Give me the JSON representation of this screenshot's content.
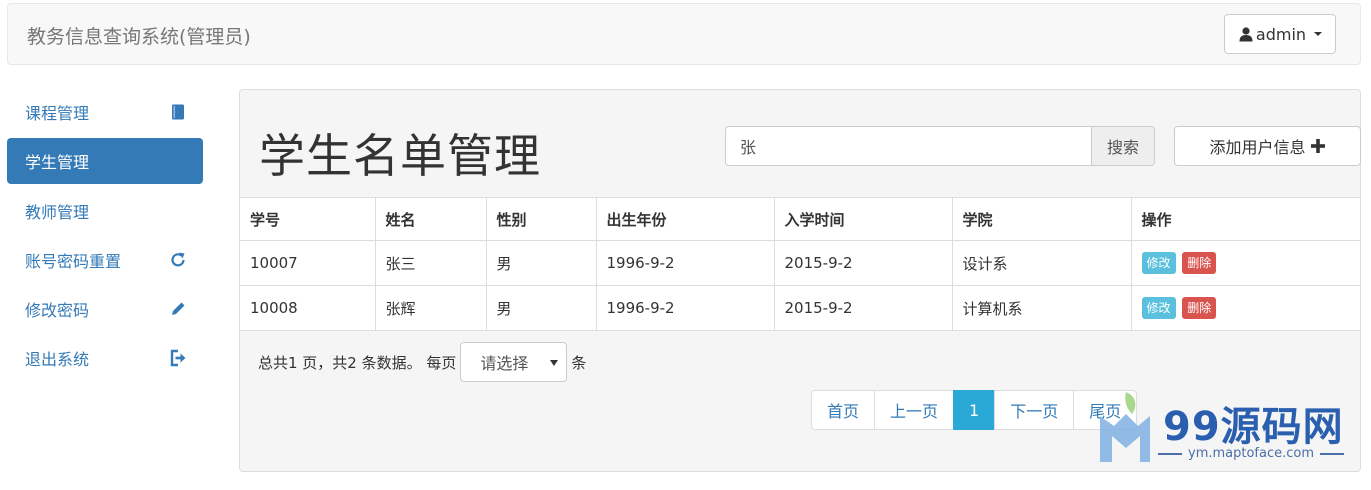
{
  "app": {
    "title": "教务信息查询系统(管理员)"
  },
  "user_menu": {
    "label": "admin",
    "icon": "user-icon"
  },
  "sidebar": {
    "items": [
      {
        "label": "课程管理",
        "icon": "book-icon",
        "active": false
      },
      {
        "label": "学生管理",
        "icon": "",
        "active": true
      },
      {
        "label": "教师管理",
        "icon": "",
        "active": false
      },
      {
        "label": "账号密码重置",
        "icon": "refresh-icon",
        "active": false
      },
      {
        "label": "修改密码",
        "icon": "pencil-icon",
        "active": false
      },
      {
        "label": "退出系统",
        "icon": "logout-icon",
        "active": false
      }
    ]
  },
  "main": {
    "title": "学生名单管理",
    "search": {
      "value": "张",
      "button_label": "搜索"
    },
    "add_button_label": "添加用户信息",
    "table": {
      "headers": [
        "学号",
        "姓名",
        "性别",
        "出生年份",
        "入学时间",
        "学院",
        "操作"
      ],
      "rows": [
        [
          "10007",
          "张三",
          "男",
          "1996-9-2",
          "2015-9-2",
          "设计系"
        ],
        [
          "10008",
          "张辉",
          "男",
          "1996-9-2",
          "2015-9-2",
          "计算机系"
        ]
      ],
      "edit_label": "修改",
      "delete_label": "删除"
    },
    "pagination_info": {
      "summary": "总共1 页，共2 条数据。 每页",
      "select_value": "请选择",
      "suffix": "条"
    },
    "pager": {
      "first": "首页",
      "prev": "上一页",
      "current": "1",
      "next": "下一页",
      "last": "尾页"
    }
  },
  "watermark": {
    "text": "99源码网",
    "sub": "ym.maptoface.com"
  },
  "colors": {
    "primary": "#337ab7",
    "info": "#5bc0de",
    "danger": "#d9534f",
    "pager_active": "#2aa8d6"
  }
}
